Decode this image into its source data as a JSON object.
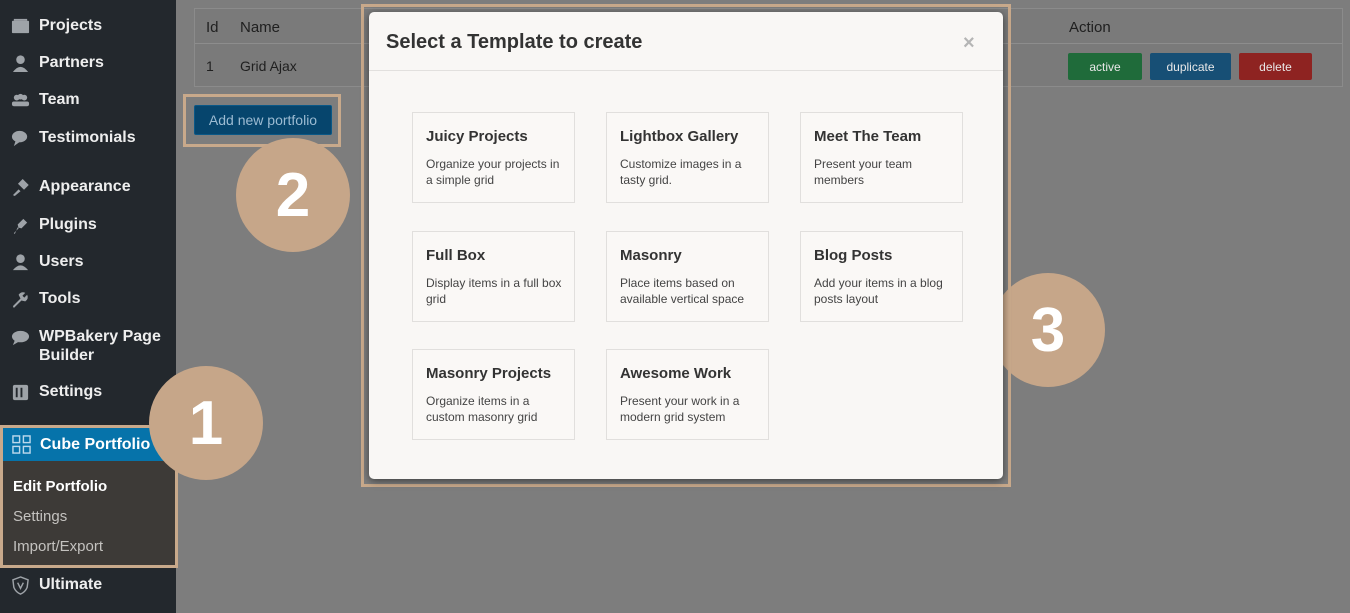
{
  "sidebar": {
    "items": [
      {
        "label": "Projects",
        "icon": "projects-icon"
      },
      {
        "label": "Partners",
        "icon": "partners-icon"
      },
      {
        "label": "Team",
        "icon": "team-icon"
      },
      {
        "label": "Testimonials",
        "icon": "testimonials-icon"
      },
      {
        "label": "Appearance",
        "icon": "appearance-icon"
      },
      {
        "label": "Plugins",
        "icon": "plugins-icon"
      },
      {
        "label": "Users",
        "icon": "users-icon"
      },
      {
        "label": "Tools",
        "icon": "tools-icon"
      },
      {
        "label": "WPBakery Page Builder",
        "icon": "wpbakery-icon"
      },
      {
        "label": "Settings",
        "icon": "settings-icon"
      },
      {
        "label": "Ultimate",
        "icon": "ultimate-icon"
      }
    ],
    "active": {
      "label": "Cube Portfolio",
      "icon": "cube-portfolio-icon"
    },
    "submenu": [
      {
        "label": "Edit Portfolio",
        "current": true
      },
      {
        "label": "Settings",
        "current": false
      },
      {
        "label": "Import/Export",
        "current": false
      }
    ]
  },
  "table": {
    "headers": {
      "id": "Id",
      "name": "Name",
      "action": "Action"
    },
    "rows": [
      {
        "id": "1",
        "name": "Grid Ajax"
      }
    ],
    "actions": {
      "active": "active",
      "duplicate": "duplicate",
      "delete": "delete"
    }
  },
  "add_button": "Add new portfolio",
  "steps": [
    "1",
    "2",
    "3"
  ],
  "modal": {
    "title": "Select a Template to create",
    "close": "×",
    "templates": [
      {
        "title": "Juicy Projects",
        "desc": "Organize your projects in a simple grid"
      },
      {
        "title": "Lightbox Gallery",
        "desc": "Customize images in a tasty grid."
      },
      {
        "title": "Meet The Team",
        "desc": "Present your team members"
      },
      {
        "title": "Full Box",
        "desc": "Display items in a full box grid"
      },
      {
        "title": "Masonry",
        "desc": "Place items based on available vertical space"
      },
      {
        "title": "Blog Posts",
        "desc": "Add your items in a blog posts layout"
      },
      {
        "title": "Masonry Projects",
        "desc": "Organize items in a custom masonry grid"
      },
      {
        "title": "Awesome Work",
        "desc": "Present your work in a modern grid system"
      }
    ]
  },
  "colors": {
    "sidebar": "#23282d",
    "overlay": "#7d7d7d",
    "highlight": "#c8a98b",
    "active_menu": "#0673aa",
    "btn_active": "#1f6b3a",
    "btn_duplicate": "#174f75",
    "btn_delete": "#8e2321"
  }
}
